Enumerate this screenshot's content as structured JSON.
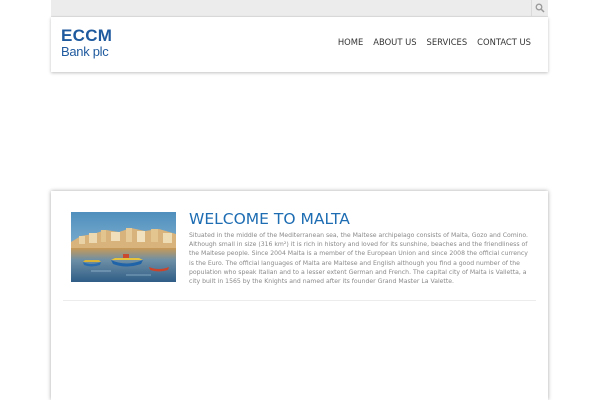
{
  "search": {
    "icon": "search-icon"
  },
  "logo": {
    "line1": "ECCM",
    "line2": "Bank plc",
    "color": "#1f5a9e"
  },
  "nav": {
    "items": [
      {
        "label": "HOME"
      },
      {
        "label": "ABOUT US"
      },
      {
        "label": "SERVICES"
      },
      {
        "label": "CONTACT US"
      }
    ]
  },
  "article": {
    "image": "malta-harbour-photo",
    "title": "WELCOME TO MALTA",
    "title_color": "#1e6db3",
    "body": "Situated in the middle of the Mediterranean sea, the Maltese archipelago consists of Malta, Gozo and Comino. Although small in size (316 km²) it is rich in history and loved for its sunshine,  beaches and the friendliness of the Maltese people.  Since 2004 Malta is a member of the European Union and since 2008 the official currency is the Euro.  The official languages of Malta are Maltese and English although you find a good number of the population who speak Italian and to a lesser extent German and French.  The capital city of Malta is Valletta, a city built in 1565 by the Knights and named after its founder Grand Master La Valette."
  }
}
